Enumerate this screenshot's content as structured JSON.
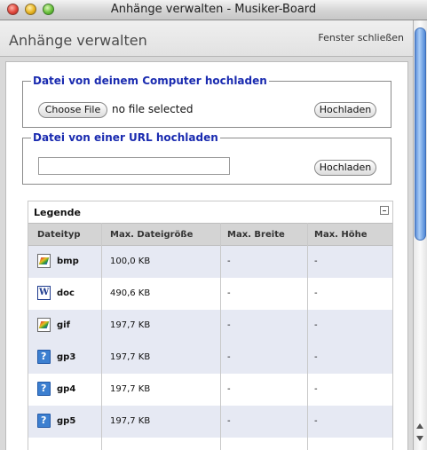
{
  "window": {
    "title": "Anhänge verwalten - Musiker-Board"
  },
  "header": {
    "title": "Anhänge verwalten",
    "close_label": "Fenster schließen"
  },
  "upload_computer": {
    "legend": "Datei von deinem Computer hochladen",
    "choose_label": "Choose File",
    "file_status": "no file selected",
    "submit_label": "Hochladen"
  },
  "upload_url": {
    "legend": "Datei von einer URL hochladen",
    "url_value": "",
    "submit_label": "Hochladen"
  },
  "legend_table": {
    "title": "Legende",
    "columns": [
      "Dateityp",
      "Max. Dateigröße",
      "Max. Breite",
      "Max. Höhe"
    ],
    "rows": [
      {
        "icon": "image-file-icon",
        "type": "bmp",
        "size": "100,0 KB",
        "width": "-",
        "height": "-"
      },
      {
        "icon": "word-document-icon",
        "type": "doc",
        "size": "490,6 KB",
        "width": "-",
        "height": "-"
      },
      {
        "icon": "image-file-icon",
        "type": "gif",
        "size": "197,7 KB",
        "width": "-",
        "height": "-"
      },
      {
        "icon": "unknown-file-icon",
        "type": "gp3",
        "size": "197,7 KB",
        "width": "-",
        "height": "-"
      },
      {
        "icon": "unknown-file-icon",
        "type": "gp4",
        "size": "197,7 KB",
        "width": "-",
        "height": "-"
      },
      {
        "icon": "unknown-file-icon",
        "type": "gp5",
        "size": "197,7 KB",
        "width": "-",
        "height": "-"
      }
    ]
  }
}
